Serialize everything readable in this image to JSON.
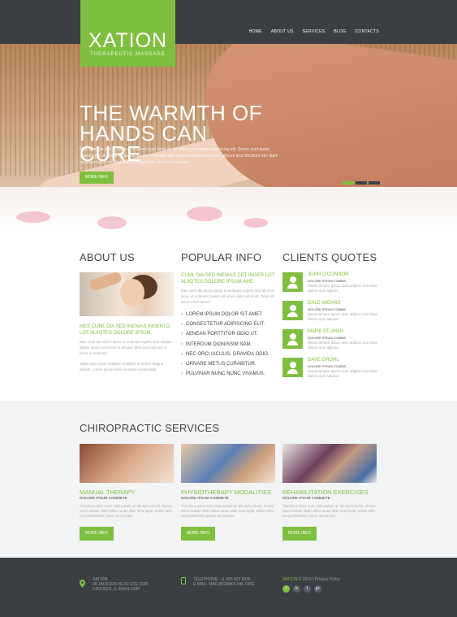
{
  "brand": {
    "name": "XATION",
    "tagline": "THERAPEUTIC MASSAGE"
  },
  "nav": [
    "HOME",
    "ABOUT US",
    "SERVICES",
    "BLOG",
    "CONTACTS"
  ],
  "hero": {
    "title_line1": "THE WARMTH OF",
    "title_line2": "HANDS CAN CURE",
    "text": "Mes cumi dia sed in lacus ut enlasant eget bene sit del dim consectetuer adipiscing elit. Donec sunt quam, ullamcorper at dictum, dolor ac auctor commodo felis mauris euismod vel nunc ultrices arcu tincidunt non diam curabitur lacus in velit tempor vehicula nec dui sed in laoreet.",
    "button": "MORE INFO",
    "slides": 3,
    "active_slide": 1
  },
  "about": {
    "title": "ABOUT US",
    "highlight": "MES CUML DIA SED INENIAS INGERTO LOT ALIIQTES DOLORE IPSUM.",
    "text1": "Mes cuml dia sed in lacus ut enlasant ingerto sed aliiqtes dolore ipsum commete ut aliquet. Mes cuml dia sed in lacus ut enlasant.",
    "text2": "Velite eum lauter mdidunt ut labore et dolore magna aliquet. Lorem ipsum dolor sit amet consectetur."
  },
  "popular": {
    "title": "POPULAR INFO",
    "highlight": "CUML DIA SED INENIAS CET INGER LOT ALIIQTES DOLORE IPSUM AME.",
    "text": "Mes cuml dia sed in lacus ut enlasant ingerto sed ali ut es lacus ut enlasant ingerto ali lorem dolor sit amet. Dolor sit amet lorem ipsum.",
    "items": [
      "LOREM IPSUM DOLOR SIT AMET.",
      "CONSECTETUR ADIPISCING ELIT.",
      "AENEAN PORTTITOR ODIO UT.",
      "INTERDUM DIGNISSIM NAM.",
      "NEC ORCI IACULIS, GRAVIDA ODIO.",
      "ORNARE METUS CURABITUR.",
      "PULVINAR NUNC NUNC VIVAMUS."
    ]
  },
  "quotes": {
    "title": "CLIENTS QUOTES",
    "items": [
      {
        "name": "JOHN O'CONNOR",
        "role": "DOLORE IPSUM COMME",
        "text": "Musta tempor ipsum dolo adipisci sed elias dolore quis adipisci."
      },
      {
        "name": "DALE MIDANS",
        "role": "DOLORE IPSUM COMME",
        "text": "Musta tempor ipsum dolo adipisci sed elias dolore quis adipisci."
      },
      {
        "name": "MARK STUMAN",
        "role": "DOLORE IPSUM COMME",
        "text": "Musta tempor ipsum dolo adipisci sed elias dolore quis adipisci."
      },
      {
        "name": "DAVE GROHL",
        "role": "DOLORE IPSUM COMME",
        "text": "Musta tempor ipsum dolo adipisci sed elias dolore quis adipisci."
      }
    ]
  },
  "services": {
    "title": "CHIROPRACTIC SERVICES",
    "items": [
      {
        "title": "MANUAL THERAPY",
        "sub": "DOLORE IPSUM COMMETE",
        "text": "Tincidunt dolor nunc vulp putate ac dis del conceit. Donec amet sedate diam ullice uman ditor scta fugia. Dolus tafio nia praeterdolo ipsum accumsan.",
        "button": "MORE INFO"
      },
      {
        "title": "PHYSIOTHERAPY MODALITIES",
        "sub": "DOLORE IPSUM COMMETE",
        "text": "Tincidunt dolor nunc vulp putate ac dis del conceit. Donec amet sedate diam ullice uman ditor scta fugia. Dolus tafio nia praeterdolo ipsum accumsan.",
        "button": "MORE INFO"
      },
      {
        "title": "REHABILITATION EXERCISES",
        "sub": "DOLORE IPSUM COMMETE",
        "text": "Tincidunt dolor nunc vulp putate ac dis del conceit. Donec amet sedate diam ullice uman ditor scta fugia. Dolus tafio nia praeterdolo ipsum accumsan.",
        "button": "MORE INFO"
      }
    ]
  },
  "footer": {
    "address1": "XATION",
    "address2": "28 JACKSON BLVD STE 1020",
    "address3": "CHICAGO, IL 60604-2340",
    "phone": "TELEPHONE: +1 800 603 6035",
    "email": "E-MAIL: MAIL@DEMOLINK.ORG",
    "copy_brand": "XATION",
    "copy_rest": "© 2014 | Privacy Policy",
    "social": [
      {
        "icon": "facebook-icon",
        "glyph": "f"
      },
      {
        "icon": "rss-icon",
        "glyph": "ʀ"
      },
      {
        "icon": "twitter-icon",
        "glyph": "t"
      },
      {
        "icon": "google-plus-icon",
        "glyph": "g+"
      }
    ]
  },
  "colors": {
    "accent": "#7fbf3f",
    "dark": "#3b3f44",
    "light_bg": "#f3f4f5"
  }
}
